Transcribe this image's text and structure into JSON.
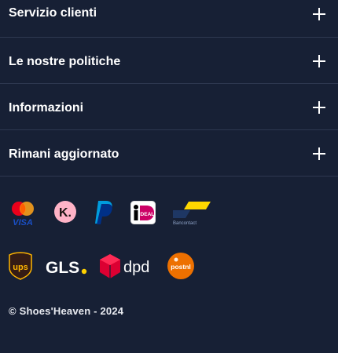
{
  "accordion": [
    {
      "label": "Servizio clienti",
      "expand_icon": "plus-icon"
    },
    {
      "label": "Le nostre politiche",
      "expand_icon": "plus-icon"
    },
    {
      "label": "Informazioni",
      "expand_icon": "plus-icon"
    },
    {
      "label": "Rimani aggiornato",
      "expand_icon": "plus-icon"
    }
  ],
  "payment_logos": {
    "mastercard_visa": {
      "text": "VISA",
      "icon": "mastercard-visa-logo"
    },
    "klarna": {
      "text": "K.",
      "icon": "klarna-logo"
    },
    "paypal": {
      "icon": "paypal-logo"
    },
    "ideal": {
      "text": "iDEAL",
      "icon": "ideal-logo"
    },
    "bancontact": {
      "text": "Bancontact",
      "icon": "bancontact-logo"
    }
  },
  "shipping_logos": {
    "ups": {
      "text": "ups",
      "icon": "ups-logo"
    },
    "gls": {
      "text": "GLS",
      "icon": "gls-logo"
    },
    "dpd": {
      "text": "dpd",
      "icon": "dpd-logo"
    },
    "postnl": {
      "text": "postnl",
      "icon": "postnl-logo"
    }
  },
  "copyright": "© Shoes'Heaven - 2024",
  "colors": {
    "background": "#172035",
    "divider": "#2e3850",
    "text": "#ffffff",
    "mastercard_red": "#eb001b",
    "mastercard_orange": "#f79e1b",
    "klarna_pink": "#ffb3c7",
    "paypal_dark": "#003087",
    "paypal_light": "#009cde",
    "ideal_magenta": "#cc0066",
    "bancontact_blue": "#1e3764",
    "bancontact_yellow": "#ffd800",
    "ups_brown": "#351c15",
    "ups_gold": "#ffb500",
    "gls_yellow": "#ffd100",
    "dpd_red": "#dc0032",
    "postnl_orange": "#ed7000"
  }
}
